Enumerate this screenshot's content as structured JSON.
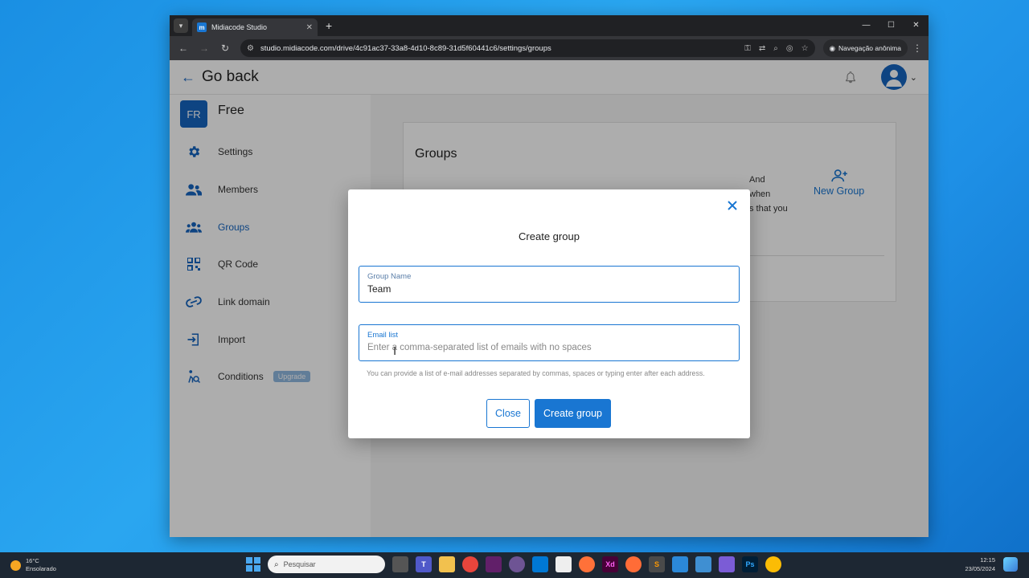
{
  "browser": {
    "tab_title": "Midiacode Studio",
    "favicon_letter": "m",
    "url": "studio.midiacode.com/drive/4c91ac37-33a8-4d10-8c89-31d5f60441c6/settings/groups",
    "incognito_label": "Navegação anônima"
  },
  "header": {
    "back_label": "Go back"
  },
  "workspace": {
    "badge": "FR",
    "name": "Free"
  },
  "sidebar": {
    "items": [
      {
        "label": "Settings",
        "icon": "gear-icon"
      },
      {
        "label": "Members",
        "icon": "people-icon"
      },
      {
        "label": "Groups",
        "icon": "groups-icon",
        "active": true
      },
      {
        "label": "QR Code",
        "icon": "qr-code-icon"
      },
      {
        "label": "Link domain",
        "icon": "link-icon"
      },
      {
        "label": "Import",
        "icon": "import-icon"
      },
      {
        "label": "Conditions",
        "icon": "conditions-icon",
        "badge": "Upgrade"
      }
    ]
  },
  "groups_card": {
    "title": "Groups",
    "desc_line1": "And",
    "desc_line2": "when",
    "desc_line3": "s that you",
    "new_group_label": "New Group"
  },
  "dialog": {
    "title": "Create group",
    "group_name_label": "Group Name",
    "group_name_value": "Team",
    "email_label": "Email list",
    "email_placeholder": "Enter a comma-separated list of emails with no spaces",
    "helper_text": "You can provide a list of e-mail addresses separated by commas, spaces or typing enter after each address.",
    "close_label": "Close",
    "create_label": "Create group"
  },
  "taskbar": {
    "temperature": "16°C",
    "weather": "Ensolarado",
    "search_placeholder": "Pesquisar",
    "time": "12:15",
    "date": "23/05/2024"
  },
  "colors": {
    "primary": "#1976d2",
    "sidebar_icon": "#1565c0"
  }
}
